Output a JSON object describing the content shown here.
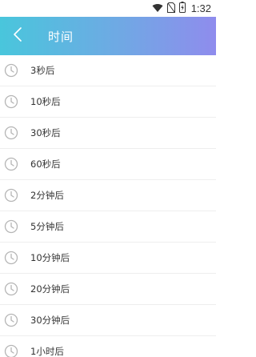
{
  "status_bar": {
    "time": "1:32",
    "icons": [
      "wifi-icon",
      "no-sim-icon",
      "battery-charging-icon"
    ]
  },
  "header": {
    "title": "时间",
    "back_icon": "chevron-left-icon",
    "gradient_colors": [
      "#49c6dc",
      "#8f8ced"
    ]
  },
  "list": {
    "item_icon": "clock-icon",
    "items": [
      {
        "label": "3秒后"
      },
      {
        "label": "10秒后"
      },
      {
        "label": "30秒后"
      },
      {
        "label": "60秒后"
      },
      {
        "label": "2分钟后"
      },
      {
        "label": "5分钟后"
      },
      {
        "label": "10分钟后"
      },
      {
        "label": "20分钟后"
      },
      {
        "label": "30分钟后"
      },
      {
        "label": "1小时后"
      }
    ]
  }
}
